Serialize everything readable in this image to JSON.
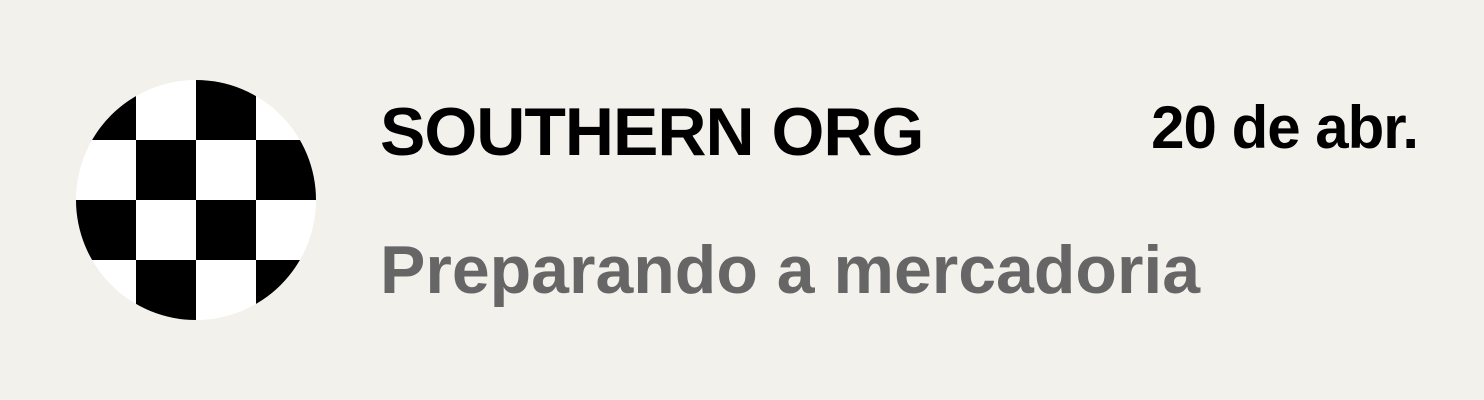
{
  "notification": {
    "sender": "SOUTHERN ORG",
    "date": "20 de abr.",
    "status": "Preparando a mercadoria",
    "avatar_icon": "checkered-flag-icon"
  },
  "colors": {
    "background": "#f2f1ec",
    "title": "#000000",
    "date": "#000000",
    "status": "#666666",
    "avatar_dark": "#000000",
    "avatar_light": "#ffffff"
  }
}
